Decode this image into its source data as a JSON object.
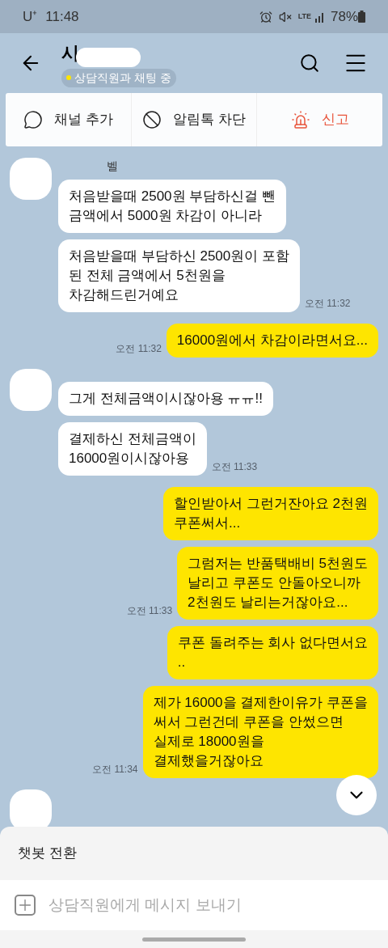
{
  "status_bar": {
    "carrier": "U⁺",
    "time": "11:48",
    "battery": "78%",
    "network": "LTE"
  },
  "header": {
    "title": "시",
    "status": "상담직원과 채팅 중",
    "online": true
  },
  "actions": [
    {
      "label": "채널 추가",
      "kind": "channel"
    },
    {
      "label": "알림톡 차단",
      "kind": "block"
    },
    {
      "label": "신고",
      "kind": "report"
    }
  ],
  "messages": [
    {
      "kind": "incoming",
      "sender": "벨",
      "bubbles": [
        {
          "text": "처음받을때 2500원 부담하신걸 뺀\n금액에서 5000원 차감이 아니라"
        },
        {
          "text": "처음받을때 부담하신 2500원이 포함\n된 전체 금액에서 5천원을\n차감해드린거예요",
          "time": "오전 11:32"
        }
      ]
    },
    {
      "kind": "outgoing",
      "bubbles": [
        {
          "text": "16000원에서 차감이라면서요...",
          "time": "오전 11:32"
        }
      ]
    },
    {
      "kind": "incoming",
      "bubbles": [
        {
          "text": "그게 전체금액이시잖아용 ㅠㅠ!!"
        },
        {
          "text": "결제하신 전체금액이\n16000원이시잖아용",
          "time": "오전 11:33"
        }
      ]
    },
    {
      "kind": "outgoing",
      "bubbles": [
        {
          "text": "할인받아서 그런거잔아요 2천원\n쿠폰써서..."
        },
        {
          "text": "그럼저는 반품택배비 5천원도\n날리고 쿠폰도 안돌아오니까\n2천원도 날리는거잖아요...",
          "time": "오전 11:33"
        },
        {
          "text": "쿠폰 돌려주는 회사 없다면서요\n.."
        },
        {
          "text": "제가 16000을 결제한이유가 쿠폰을\n써서 그런건데 쿠폰을 안썼으면\n실제로 18000원을\n결제했을거잖아요",
          "time": "오전 11:34"
        }
      ]
    },
    {
      "kind": "incoming"
    }
  ],
  "bottom": {
    "chatbot_button": "챗봇 전환",
    "input_placeholder": "상담직원에게 메시지 보내기"
  }
}
